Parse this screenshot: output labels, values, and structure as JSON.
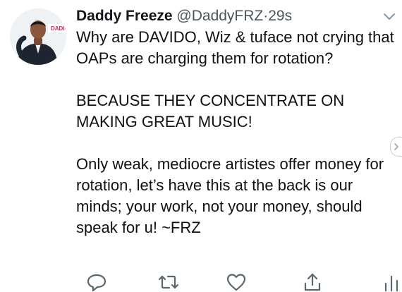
{
  "tweet": {
    "author": {
      "display_name": "Daddy Freeze",
      "handle": "@DaddyFRZ",
      "separator": "·",
      "timestamp": "29s"
    },
    "avatar": {
      "logo_text": "DADIO"
    },
    "body": {
      "paragraphs": [
        "Why are DAVIDO, Wiz & tuface not crying that OAPs are charging them for rotation?",
        "BECAUSE THEY CONCENTRATE ON MAKING GREAT MUSIC!",
        "Only weak, mediocre artistes offer money for rotation, let’s have this at the back is our minds; your work, not your money, should speak for u! ~FRZ"
      ]
    },
    "icons": {
      "menu": "chevron-down-icon",
      "reply": "reply-icon",
      "retweet": "retweet-icon",
      "like": "heart-icon",
      "share": "share-icon",
      "analytics": "analytics-icon",
      "side": "chevron-right-icon"
    },
    "colors": {
      "text": "#111111",
      "muted": "#4a5560",
      "icon": "#5b6770",
      "brand": "#e0245e"
    }
  }
}
